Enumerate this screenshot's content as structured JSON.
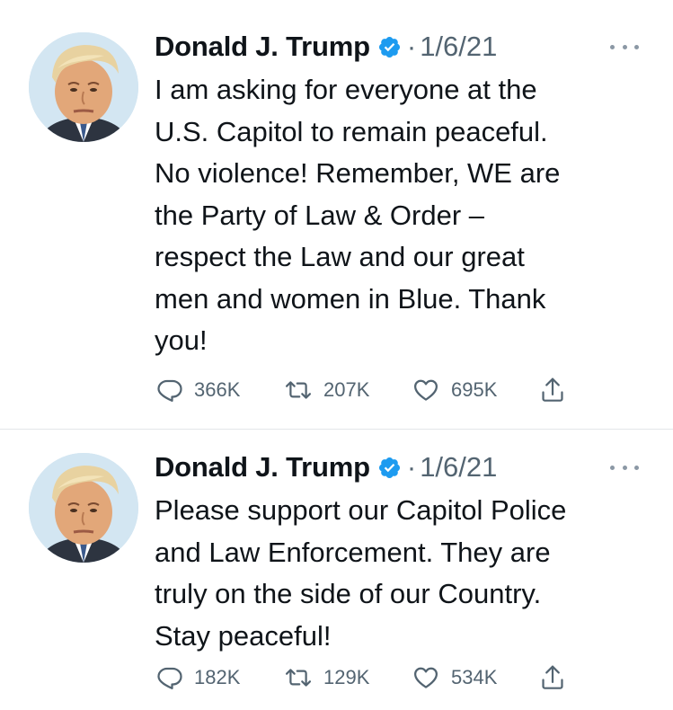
{
  "tweets": [
    {
      "author": "Donald J. Trump",
      "separator": "·",
      "date": "1/6/21",
      "lines": [
        "I am asking for everyone at the",
        "U.S. Capitol to remain peaceful.",
        "No violence! Remember, WE are",
        "the Party of Law & Order –",
        "respect the Law and our great",
        "men and women in Blue. Thank",
        "you!"
      ],
      "replies": "366K",
      "retweets": "207K",
      "likes": "695K"
    },
    {
      "author": "Donald J. Trump",
      "separator": "·",
      "date": "1/6/21",
      "lines": [
        "Please support our Capitol Police",
        "and Law Enforcement. They are",
        "truly on the side of our Country.",
        "Stay peaceful!"
      ],
      "replies": "182K",
      "retweets": "129K",
      "likes": "534K"
    }
  ],
  "icons": {
    "verified": "verified-badge-icon",
    "more": "more-horizontal-icon",
    "reply": "reply-icon",
    "retweet": "retweet-icon",
    "like": "heart-icon",
    "share": "share-icon"
  },
  "colors": {
    "verified": "#1d9bf0",
    "text": "#0f1419",
    "secondary": "#536471",
    "divider": "#e3e6e9"
  }
}
